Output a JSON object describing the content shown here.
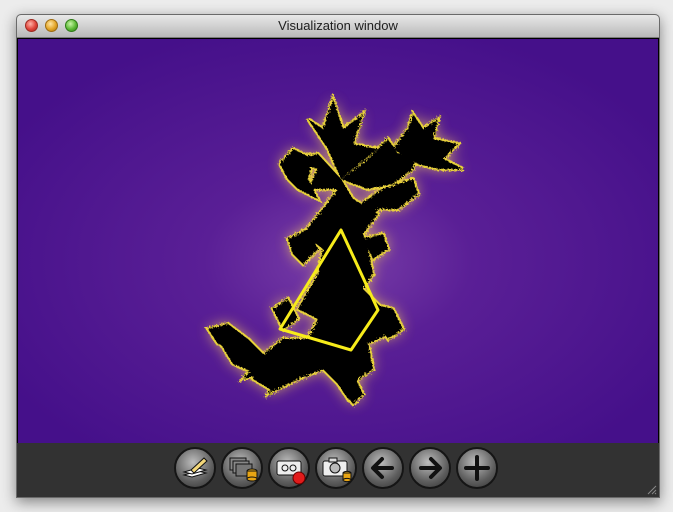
{
  "window": {
    "title": "Visualization window"
  },
  "canvas": {
    "background_color": "#4a0f85",
    "fractal_color": "#000000",
    "edge_glow_color": "#f0c84a",
    "polygon_color": "#f7ec1a"
  },
  "toolbar": {
    "buttons": [
      {
        "icon": "edit-pencil-icon"
      },
      {
        "icon": "layers-export-icon"
      },
      {
        "icon": "record-video-icon"
      },
      {
        "icon": "camera-save-icon"
      },
      {
        "icon": "arrow-left-icon"
      },
      {
        "icon": "arrow-right-icon"
      },
      {
        "icon": "plus-icon"
      }
    ]
  }
}
